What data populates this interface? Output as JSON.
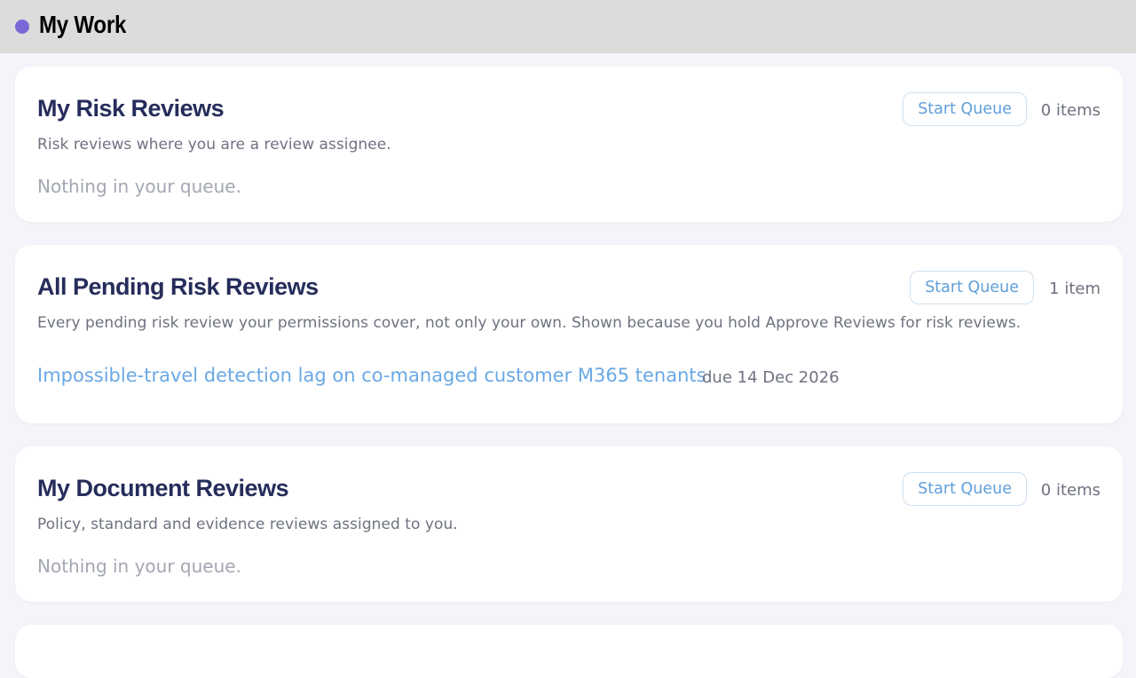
{
  "header": {
    "title": "My Work",
    "dot_color": "#7b68d6"
  },
  "cards": [
    {
      "title": "My Risk Reviews",
      "description": "Risk reviews where you are a review assignee.",
      "button_label": "Start Queue",
      "count": "0 items",
      "empty_text": "Nothing in your queue."
    },
    {
      "title": "All Pending Risk Reviews",
      "description": "Every pending risk review your permissions cover, not only your own. Shown because you hold Approve Reviews for risk reviews.",
      "button_label": "Start Queue",
      "count": "1 item",
      "items": [
        {
          "title": "Impossible-travel detection lag on co-managed customer M365 tenants",
          "due": "due 14 Dec 2026"
        }
      ]
    },
    {
      "title": "My Document Reviews",
      "description": "Policy, standard and evidence reviews assigned to you.",
      "button_label": "Start Queue",
      "count": "0 items",
      "empty_text": "Nothing in your queue."
    }
  ],
  "colors": {
    "accent": "#5f9fd9",
    "link": "#6aa8e5",
    "heading": "#262d5b",
    "background": "#f4f5fa"
  }
}
